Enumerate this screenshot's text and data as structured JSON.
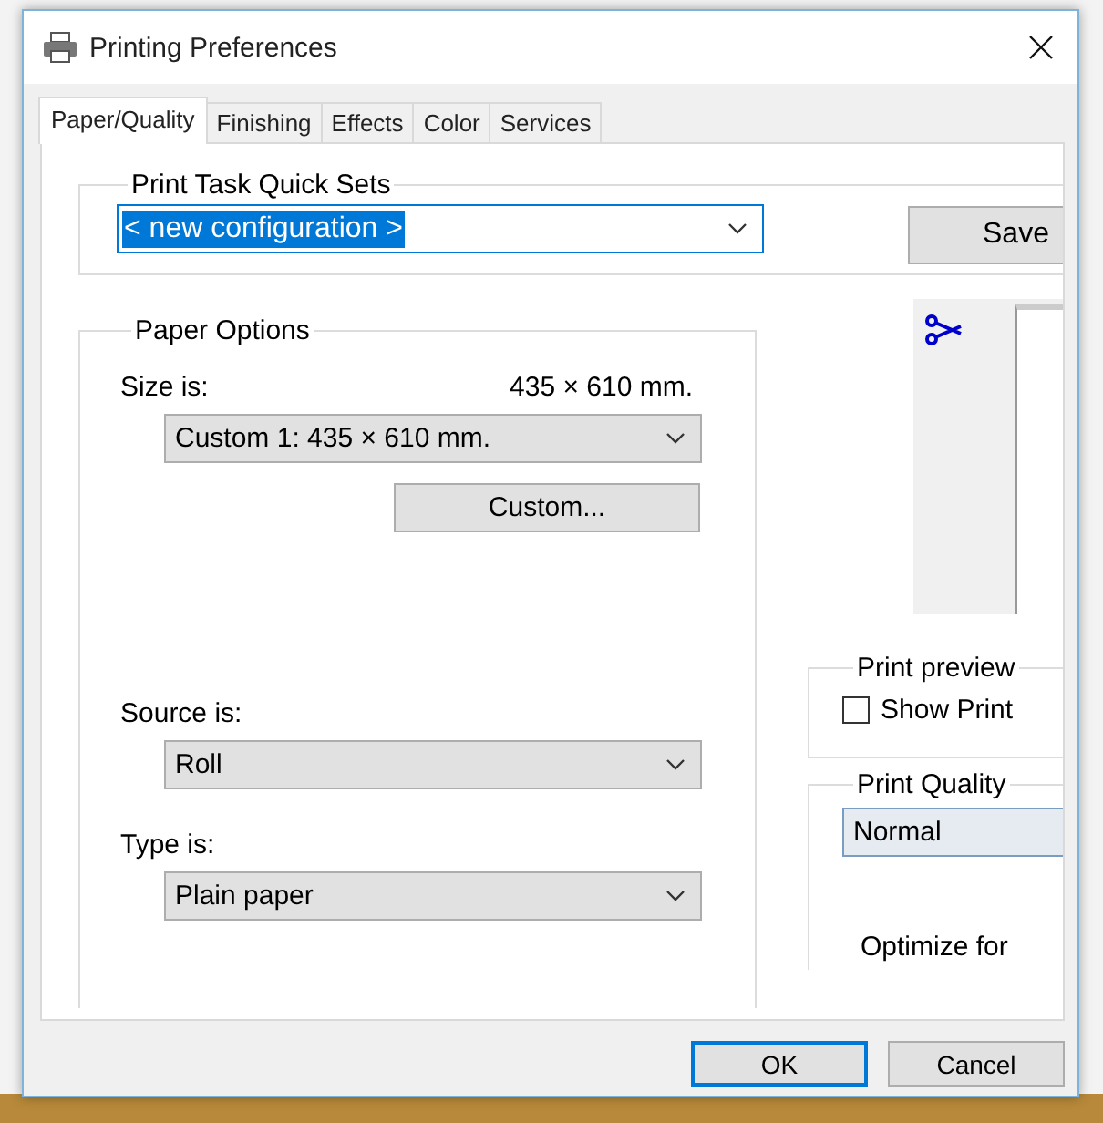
{
  "window": {
    "title": "Printing Preferences"
  },
  "tabs": [
    {
      "label": "Paper/Quality",
      "selected": true
    },
    {
      "label": "Finishing",
      "selected": false
    },
    {
      "label": "Effects",
      "selected": false
    },
    {
      "label": "Color",
      "selected": false
    },
    {
      "label": "Services",
      "selected": false
    }
  ],
  "quick_sets": {
    "title": "Print Task Quick Sets",
    "value": "< new configuration >",
    "save_button": "Save"
  },
  "paper_options": {
    "title": "Paper Options",
    "size_label": "Size is:",
    "size_reading": "435 × 610 mm.",
    "size_value": "Custom 1:  435 × 610 mm.",
    "custom_button": "Custom...",
    "source_label": "Source is:",
    "source_value": "Roll",
    "type_label": "Type is:",
    "type_value": "Plain paper"
  },
  "print_preview": {
    "title": "Print preview",
    "checkbox": {
      "label": "Show Print",
      "checked": false
    }
  },
  "print_quality": {
    "title": "Print Quality",
    "value": "Normal",
    "optimize_label": "Optimize for"
  },
  "buttons": [
    {
      "label": "OK",
      "default": true
    },
    {
      "label": "Cancel",
      "default": false
    }
  ]
}
